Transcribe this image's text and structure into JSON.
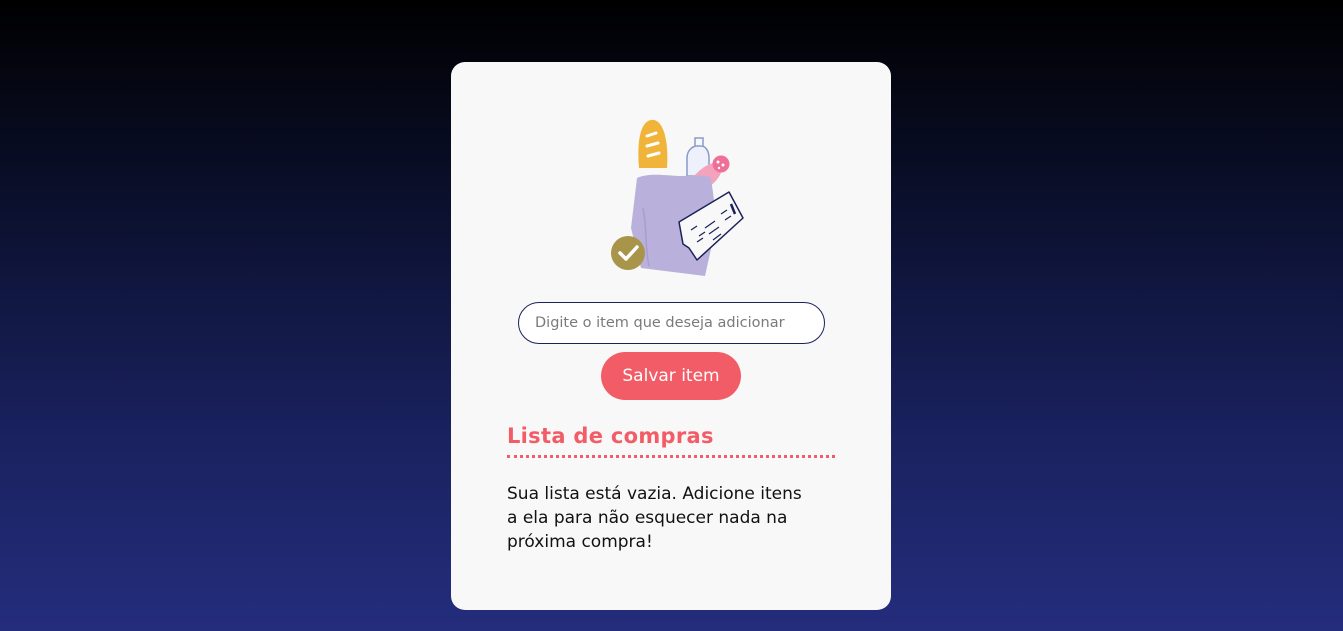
{
  "form": {
    "item_placeholder": "Digite o item que deseja adicionar",
    "item_value": "",
    "save_label": "Salvar item"
  },
  "list": {
    "title": "Lista de compras",
    "empty_message": "Sua lista está vazia. Adicione itens a ela para não esquecer nada na próxima compra!"
  },
  "illustration": {
    "icon": "grocery-bag-illustration",
    "check_icon": "check-icon"
  },
  "colors": {
    "accent": "#f25c66",
    "navy": "#1b2259",
    "card": "#f8f8f8",
    "bag": "#b9b1dc",
    "bread": "#f0b43a",
    "check": "#a8954a"
  }
}
